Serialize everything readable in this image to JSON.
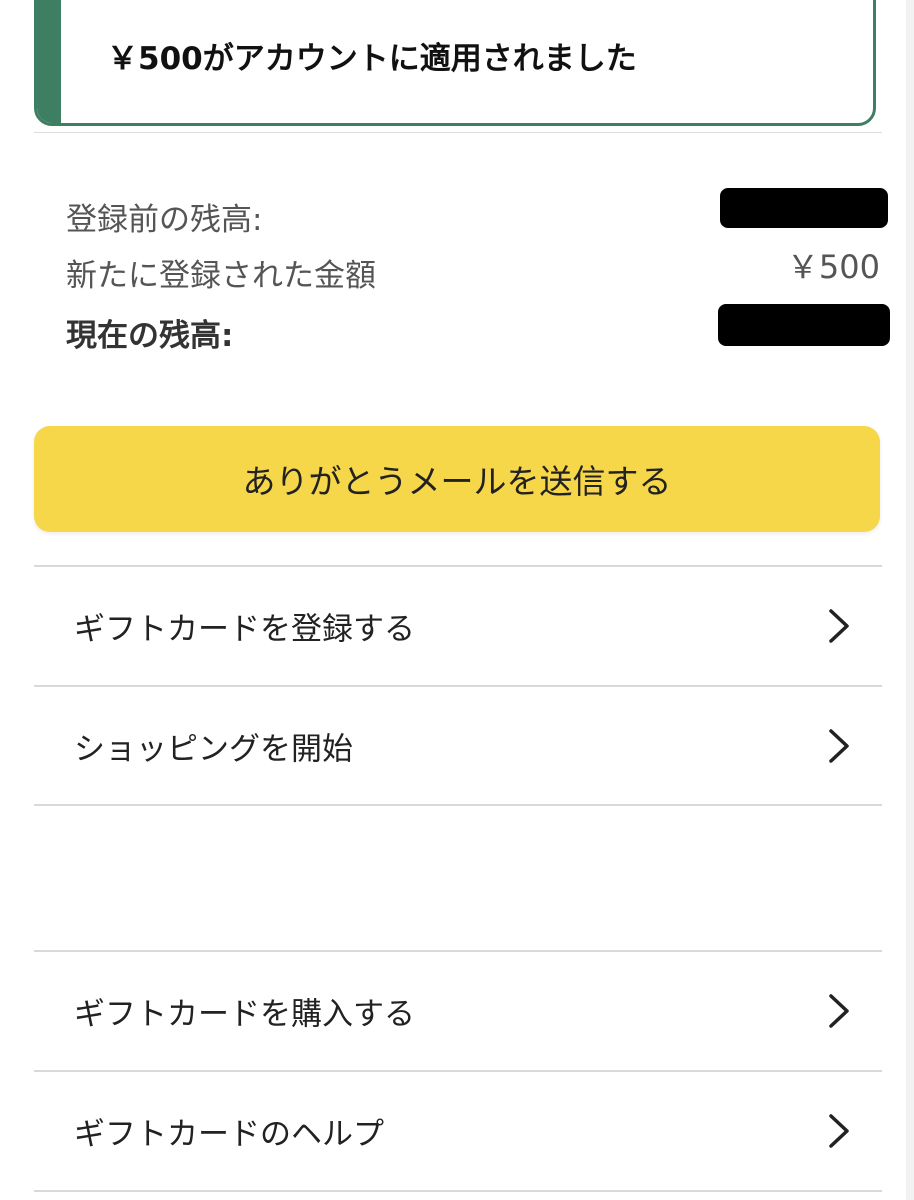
{
  "alert": {
    "message": "￥500がアカウントに適用されました",
    "accent_color": "#3e7f63"
  },
  "balance": {
    "rows": [
      {
        "label": "登録前の残高:",
        "value": "",
        "redacted": true
      },
      {
        "label": "新たに登録された金額",
        "value": "￥500",
        "redacted": false
      },
      {
        "label": "現在の残高:",
        "value": "",
        "redacted": true
      }
    ]
  },
  "primary_button": {
    "label": "ありがとうメールを送信する",
    "color": "#f7d74a"
  },
  "menu": {
    "items": [
      {
        "label": "ギフトカードを登録する",
        "icon": "chevron-right-icon"
      },
      {
        "label": "ショッピングを開始",
        "icon": "chevron-right-icon"
      },
      {
        "label": "ギフトカードを購入する",
        "icon": "chevron-right-icon"
      },
      {
        "label": "ギフトカードのヘルプ",
        "icon": "chevron-right-icon"
      }
    ]
  }
}
